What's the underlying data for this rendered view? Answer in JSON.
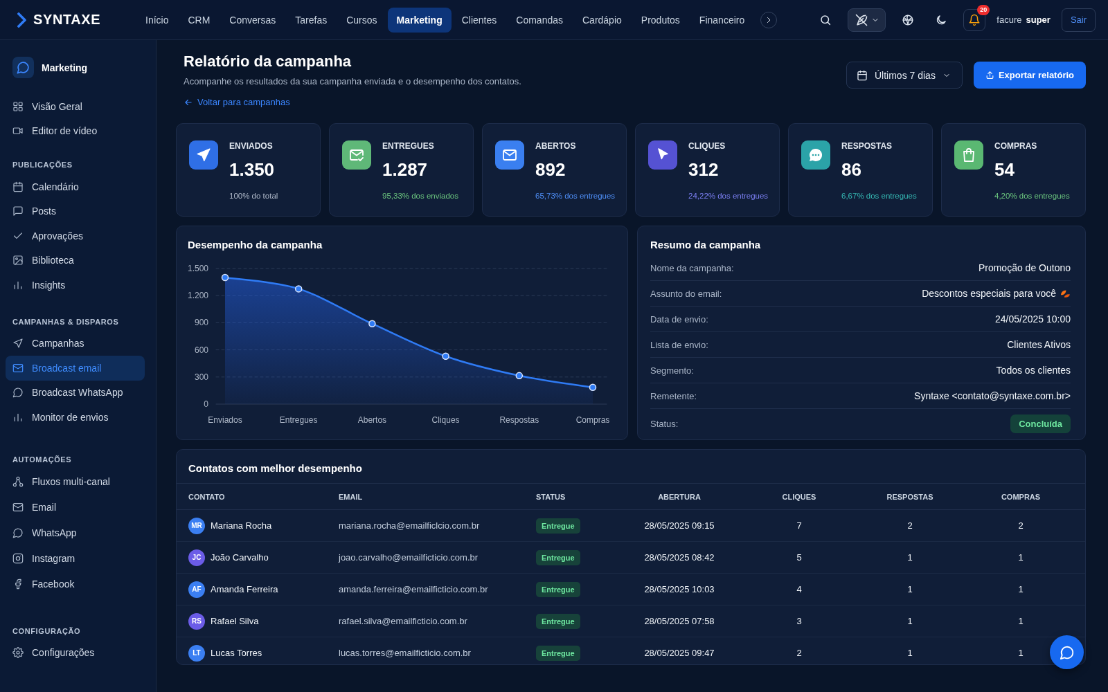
{
  "topbar": {
    "logo": "SYNTAXE",
    "nav": [
      {
        "label": "Início",
        "selected": false
      },
      {
        "label": "CRM",
        "selected": false
      },
      {
        "label": "Conversas",
        "selected": false
      },
      {
        "label": "Tarefas",
        "selected": false
      },
      {
        "label": "Cursos",
        "selected": false
      },
      {
        "label": "Marketing",
        "selected": true
      },
      {
        "label": "Clientes",
        "selected": false
      },
      {
        "label": "Comandas",
        "selected": false
      },
      {
        "label": "Cardápio",
        "selected": false
      },
      {
        "label": "Produtos",
        "selected": false
      },
      {
        "label": "Financeiro",
        "selected": false
      }
    ],
    "notifications_badge": "20",
    "user_name": "facure",
    "user_role": "super",
    "logout": "Sair"
  },
  "sidebar": {
    "title": "Marketing",
    "items": [
      {
        "label": "Visão Geral",
        "selected": false
      },
      {
        "label": "Editor de vídeo",
        "selected": false
      }
    ],
    "sections": [
      {
        "heading": "PUBLICAÇÕES",
        "items": [
          {
            "label": "Calendário",
            "selected": false
          },
          {
            "label": "Posts",
            "selected": false
          },
          {
            "label": "Aprovações",
            "selected": false
          },
          {
            "label": "Biblioteca",
            "selected": false
          },
          {
            "label": "Insights",
            "selected": false
          }
        ]
      },
      {
        "heading": "CAMPANHAS & DISPAROS",
        "items": [
          {
            "label": "Campanhas",
            "selected": false
          },
          {
            "label": "Broadcast email",
            "selected": true
          },
          {
            "label": "Broadcast WhatsApp",
            "selected": false
          },
          {
            "label": "Monitor de envios",
            "selected": false
          }
        ]
      },
      {
        "heading": "AUTOMAÇÕES",
        "items": [
          {
            "label": "Fluxos multi-canal",
            "selected": false
          },
          {
            "label": "Email",
            "selected": false
          },
          {
            "label": "WhatsApp",
            "selected": false
          },
          {
            "label": "Instagram",
            "selected": false
          },
          {
            "label": "Facebook",
            "selected": false
          }
        ]
      },
      {
        "heading": "CONFIGURAÇÃO",
        "items": [
          {
            "label": "Configurações",
            "selected": false
          }
        ]
      }
    ]
  },
  "header": {
    "title": "Relatório da campanha",
    "subtitle": "Acompanhe os resultados da sua campanha enviada e o desempenho dos contatos.",
    "back_link": "Voltar para campanhas",
    "period": "Últimos 7 dias",
    "export_button": "Exportar relatório"
  },
  "stats": [
    {
      "label": "ENVIADOS",
      "value": "1.350",
      "color": "#2f6fe6",
      "note": {
        "text": "100% do total",
        "color": "#aeb8c8"
      }
    },
    {
      "label": "ENTREGUES",
      "value": "1.287",
      "color": "#5fb878",
      "note": {
        "text": "95,33% dos enviados",
        "color": "#6cc77f"
      }
    },
    {
      "label": "ABERTOS",
      "value": "892",
      "color": "#3a7ff0",
      "note": {
        "text": "65,73% dos entregues",
        "color": "#4f8ff7"
      }
    },
    {
      "label": "CLIQUES",
      "value": "312",
      "color": "#5552d3",
      "note": {
        "text": "24,22% dos entregues",
        "color": "#7b7ff2"
      }
    },
    {
      "label": "RESPOSTAS",
      "value": "86",
      "color": "#2ba3a8",
      "note": {
        "text": "6,67% dos entregues",
        "color": "#35b8b3"
      }
    },
    {
      "label": "COMPRAS",
      "value": "54",
      "color": "#5ab872",
      "note": {
        "text": "4,20% dos entregues",
        "color": "#6cc77f"
      }
    }
  ],
  "performance": {
    "title": "Desempenho da campanha",
    "chart_data": {
      "type": "area",
      "categories": [
        "Enviados",
        "Entregues",
        "Abertos",
        "Cliques",
        "Respostas",
        "Compras"
      ],
      "values": [
        1400,
        1275,
        890,
        530,
        315,
        185
      ],
      "ylim": [
        0,
        1500
      ],
      "yticks": [
        0,
        300,
        600,
        900,
        {
          "value": 1200,
          "label": "1.200"
        },
        {
          "value": 1500,
          "label": "1.500"
        }
      ],
      "grid": true
    }
  },
  "summary": {
    "title": "Resumo da campanha",
    "rows": [
      {
        "label": "Nome da campanha:",
        "value": "Promoção de Outono",
        "kind": "text"
      },
      {
        "label": "Assunto do email:",
        "value": "Descontos especiais para você",
        "kind": "decorated"
      },
      {
        "label": "Data de envio:",
        "value": "24/05/2025 10:00",
        "kind": "text"
      },
      {
        "label": "Lista de envio:",
        "value": "Clientes Ativos",
        "kind": "text"
      },
      {
        "label": "Segmento:",
        "value": "Todos os clientes",
        "kind": "text"
      },
      {
        "label": "Remetente:",
        "value": "Syntaxe <contato@syntaxe.com.br>",
        "kind": "text"
      },
      {
        "label": "Status:",
        "value": "Concluída",
        "kind": "badge"
      }
    ]
  },
  "contacts": {
    "title": "Contatos com melhor desempenho",
    "columns": [
      "CONTATO",
      "EMAIL",
      "STATUS",
      "ABERTURA",
      "CLIQUES",
      "RESPOSTAS",
      "COMPRAS"
    ],
    "rows": [
      {
        "initials": "MR",
        "color": "#3b7ff2",
        "name": "Mariana Rocha",
        "email": "mariana.rocha@emailficlcio.com.br",
        "status": "Entregue",
        "opened": "28/05/2025 09:15",
        "clicks": "7",
        "replies": "2",
        "purchases": "2"
      },
      {
        "initials": "JC",
        "color": "#6b5ce7",
        "name": "João Carvalho",
        "email": "joao.carvalho@emailficticio.com.br",
        "status": "Entregue",
        "opened": "28/05/2025 08:42",
        "clicks": "5",
        "replies": "1",
        "purchases": "1"
      },
      {
        "initials": "AF",
        "color": "#3b7ff2",
        "name": "Amanda Ferreira",
        "email": "amanda.ferreira@emailficticio.com.br",
        "status": "Entregue",
        "opened": "28/05/2025 10:03",
        "clicks": "4",
        "replies": "1",
        "purchases": "1"
      },
      {
        "initials": "RS",
        "color": "#6b5ce7",
        "name": "Rafael Silva",
        "email": "rafael.silva@emailficticio.com.br",
        "status": "Entregue",
        "opened": "28/05/2025 07:58",
        "clicks": "3",
        "replies": "1",
        "purchases": "1"
      },
      {
        "initials": "LT",
        "color": "#3b7ff2",
        "name": "Lucas Torres",
        "email": "lucas.torres@emailficticio.com.br",
        "status": "Entregue",
        "opened": "28/05/2025 09:47",
        "clicks": "2",
        "replies": "1",
        "purchases": "1"
      }
    ]
  }
}
